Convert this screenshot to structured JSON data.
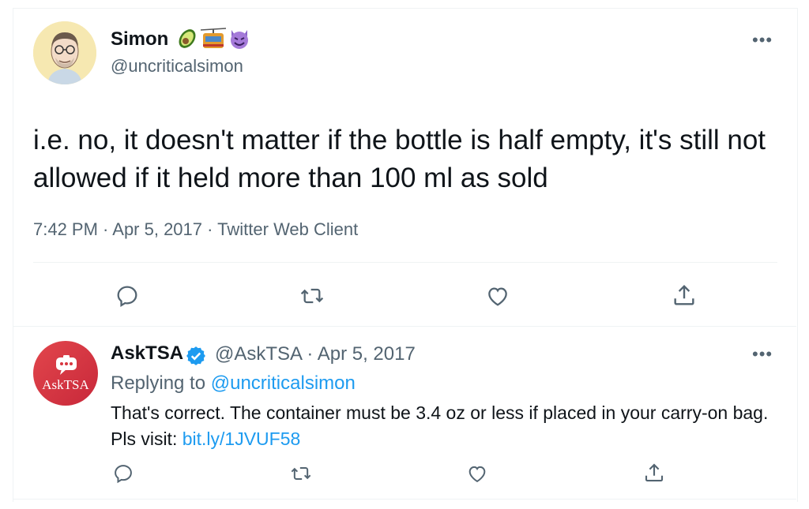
{
  "main_tweet": {
    "author_name": "Simon",
    "author_emojis": [
      "avocado",
      "aerial-tramway",
      "smiling-imp"
    ],
    "author_handle": "@uncriticalsimon",
    "text": "i.e. no, it doesn't matter if the bottle is half empty, it's still not allowed if it held more than 100 ml as sold",
    "meta": "7:42 PM · Apr 5, 2017 · Twitter Web Client",
    "more_label": "•••",
    "actions": [
      "reply-icon",
      "retweet-icon",
      "like-icon",
      "share-icon"
    ]
  },
  "reply_tweet": {
    "avatar_label": "AskTSA",
    "author_name": "AskTSA",
    "author_handle_date": "@AskTSA · Apr 5, 2017",
    "replying_prefix": "Replying to ",
    "replying_handle": "@uncriticalsimon",
    "text_before_link": "That's correct. The container must be 3.4 oz or less if placed in your carry-on bag. Pls visit: ",
    "link": "bit.ly/1JVUF58",
    "more_label": "•••",
    "actions": [
      "reply-icon",
      "retweet-icon",
      "like-icon",
      "share-icon"
    ]
  },
  "colors": {
    "text": "#0f1419",
    "secondary": "#536471",
    "link": "#1d9bf0",
    "divider": "#eff3f4",
    "tsa_red": "#d8363f"
  }
}
